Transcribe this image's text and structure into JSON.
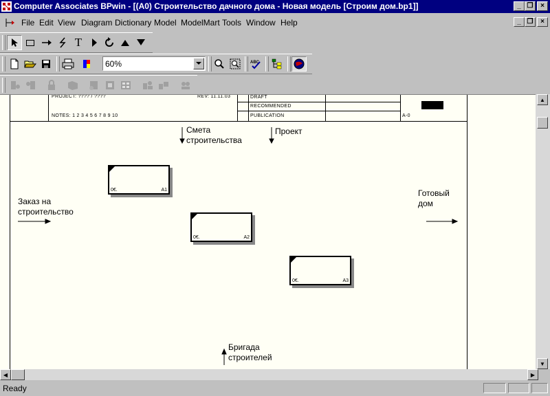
{
  "window": {
    "title": "Computer Associates BPwin - [(A0) Строительство дачного дома - Новая модель  [Строим дом.bp1]]"
  },
  "menu": {
    "items": [
      {
        "label": "File"
      },
      {
        "label": "Edit"
      },
      {
        "label": "View"
      },
      {
        "label": "Diagram"
      },
      {
        "label": "Dictionary"
      },
      {
        "label": "Model"
      },
      {
        "label": "ModelMart"
      },
      {
        "label": "Tools"
      },
      {
        "label": "Window"
      },
      {
        "label": "Help"
      }
    ]
  },
  "toolbar": {
    "zoom_value": "60%"
  },
  "frame": {
    "project": "PROJECT:  ???? / ????",
    "rev": "REV:   11.11.03",
    "notes": "NOTES:  1  2  3  4  5  6  7  8  9  10",
    "draft": "DRAFT",
    "recommended": "RECOMMENDED",
    "publication": "PUBLICATION",
    "node": "A-0"
  },
  "diagram": {
    "labels": {
      "cost_estimate": "Смета\nстроительства",
      "project": "Проект",
      "order": "Заказ на\nстроительство",
      "finished_house": "Готовый\nдом",
      "crew": "Бригада\nстроителей"
    },
    "boxes": [
      {
        "cost": "0€.",
        "node": "A1"
      },
      {
        "cost": "0€.",
        "node": "A2"
      },
      {
        "cost": "0€.",
        "node": "A3"
      }
    ]
  },
  "status": {
    "text": "Ready"
  },
  "colors": {
    "titlebar": "#000080",
    "canvas": "#fffff5"
  }
}
